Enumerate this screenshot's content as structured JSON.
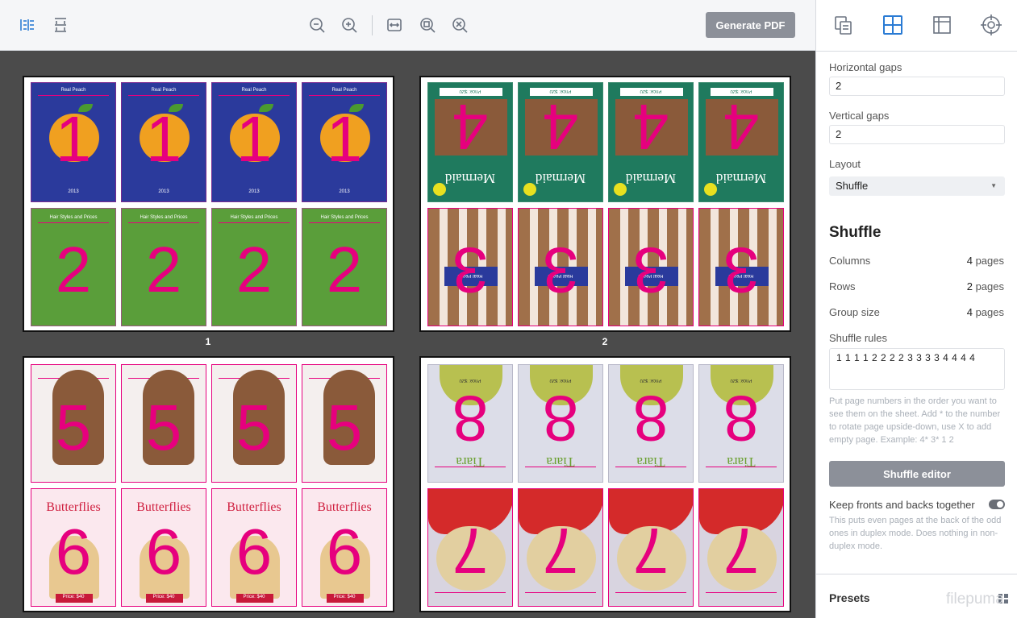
{
  "toolbar": {
    "generate_label": "Generate PDF",
    "icons": [
      "columns-view-icon",
      "rows-view-icon",
      "zoom-out-icon",
      "zoom-in-icon",
      "fit-width-icon",
      "fit-page-icon",
      "zoom-reset-icon"
    ]
  },
  "canvas": {
    "sheets": [
      {
        "label": "1"
      },
      {
        "label": "2"
      }
    ]
  },
  "tiles": {
    "p1_header": "Real Peach",
    "p1_year": "2013",
    "p2_header": "Hair Styles and Prices",
    "p4_price": "Price: $20",
    "p4_title": "Mermaid",
    "p3_logo": "Real Peach",
    "p8_price": "Price: $20",
    "p8_title": "Tiara",
    "p6_title": "Butterflies",
    "p6_price": "Price: $40",
    "numbers": {
      "n1": "1",
      "n2": "2",
      "n3": "3",
      "n4": "4",
      "n5": "5",
      "n6": "6",
      "n7": "7",
      "n8": "8"
    }
  },
  "sidebar": {
    "tabs": [
      "duplicate-pages-icon",
      "layout-grid-icon",
      "margins-icon",
      "target-icon"
    ],
    "horizontal_gaps_label": "Horizontal gaps",
    "horizontal_gaps_value": "2",
    "vertical_gaps_label": "Vertical gaps",
    "vertical_gaps_value": "2",
    "layout_label": "Layout",
    "layout_value": "Shuffle",
    "section_title": "Shuffle",
    "columns_label": "Columns",
    "columns_value": "4",
    "rows_label": "Rows",
    "rows_value": "2",
    "group_label": "Group size",
    "group_value": "4",
    "unit": "pages",
    "rules_label": "Shuffle rules",
    "rules_value": "1 1 1 1 2 2 2 2 3 3 3 3 4 4 4 4",
    "rules_help": "Put page numbers in the order you want to see them on the sheet. Add * to the number to rotate page upside-down, use X to add empty page. Example: 4* 3* 1 2",
    "editor_label": "Shuffle editor",
    "keep_label": "Keep fronts and backs together",
    "keep_help": "This puts even pages at the back of the odd ones in duplex mode. Does nothing in non-duplex mode.",
    "presets_label": "Presets"
  },
  "watermark": "filepuma",
  "colors": {
    "accent": "#2a7bd4",
    "magenta": "#e6007e",
    "button": "#8c9099"
  }
}
